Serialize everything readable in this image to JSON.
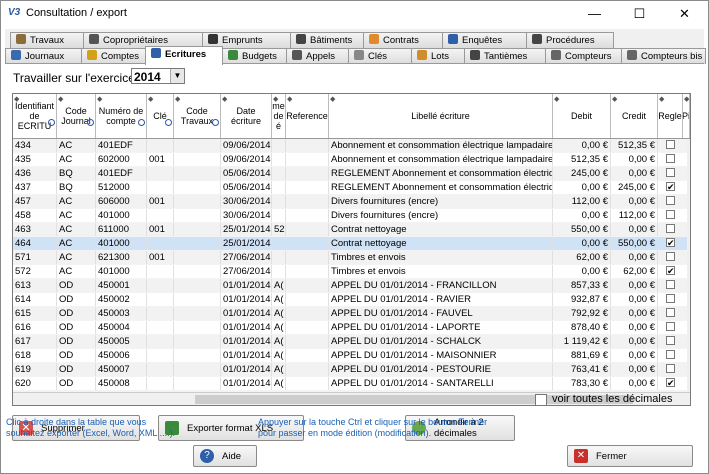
{
  "window": {
    "app_icon_text": "V3",
    "title": "Consultation / export",
    "minimize": "—",
    "maximize": "☐",
    "close": "✕"
  },
  "tabs_row1": [
    {
      "label": "Travaux",
      "icon": "wrench-icon",
      "color": "#8a6d3b"
    },
    {
      "label": "Copropriétaires",
      "icon": "people-icon",
      "color": "#555555"
    },
    {
      "label": "Emprunts",
      "icon": "card-icon",
      "color": "#333333"
    },
    {
      "label": "Bâtiments",
      "icon": "building-icon",
      "color": "#444444"
    },
    {
      "label": "Contrats",
      "icon": "handshake-icon",
      "color": "#e08a2c"
    },
    {
      "label": "Enquêtes",
      "icon": "question-icon",
      "color": "#2f5fa8"
    },
    {
      "label": "Procédures",
      "icon": "gavel-icon",
      "color": "#444444"
    }
  ],
  "tabs_row2": [
    {
      "label": "Journaux",
      "icon": "journal-icon",
      "color": "#3a6ab0"
    },
    {
      "label": "Comptes",
      "icon": "coins-icon",
      "color": "#d4a017"
    },
    {
      "label": "Ecritures",
      "icon": "ledger-icon",
      "color": "#2f5fa8",
      "active": true
    },
    {
      "label": "Budgets",
      "icon": "chart-icon",
      "color": "#3b8a3b"
    },
    {
      "label": "Appels",
      "icon": "bell-icon",
      "color": "#555555"
    },
    {
      "label": "Clés",
      "icon": "key-icon",
      "color": "#888888"
    },
    {
      "label": "Lots",
      "icon": "house-icon",
      "color": "#d08c2a"
    },
    {
      "label": "Tantièmes",
      "icon": "bars-icon",
      "color": "#444444"
    },
    {
      "label": "Compteurs",
      "icon": "meter-icon",
      "color": "#666666"
    },
    {
      "label": "Compteurs bis",
      "icon": "meter-icon",
      "color": "#666666"
    }
  ],
  "exercise": {
    "label": "Travailler sur l'exercice",
    "value": "2014",
    "arrow": "▼"
  },
  "columns": [
    "Identifiant de ECRITU",
    "Code Journal",
    "Numéro de compte",
    "Clé",
    "Code Travaux",
    "Date écriture",
    "me de é",
    "Reference",
    "Libellé écriture",
    "Debit",
    "Credit",
    "Regle",
    "Pi"
  ],
  "rows": [
    {
      "id": "434",
      "journal": "AC",
      "compte": "401EDF",
      "cle": "",
      "travaux": "",
      "date": "09/06/2014",
      "me": "",
      "ref": "",
      "libelle": "Abonnement et consommation électrique lampadaires",
      "debit": "0,00 €",
      "credit": "512,35 €",
      "regle": false
    },
    {
      "id": "435",
      "journal": "AC",
      "compte": "602000",
      "cle": "001",
      "travaux": "",
      "date": "09/06/2014",
      "me": "",
      "ref": "",
      "libelle": "Abonnement et consommation électrique lampadaires",
      "debit": "512,35 €",
      "credit": "0,00 €",
      "regle": false
    },
    {
      "id": "436",
      "journal": "BQ",
      "compte": "401EDF",
      "cle": "",
      "travaux": "",
      "date": "05/06/2014",
      "me": "",
      "ref": "",
      "libelle": "REGLEMENT Abonnement et consommation électrique lan",
      "debit": "245,00 €",
      "credit": "0,00 €",
      "regle": false
    },
    {
      "id": "437",
      "journal": "BQ",
      "compte": "512000",
      "cle": "",
      "travaux": "",
      "date": "05/06/2014",
      "me": "",
      "ref": "",
      "libelle": "REGLEMENT Abonnement et consommation électrique lan",
      "debit": "0,00 €",
      "credit": "245,00 €",
      "regle": true
    },
    {
      "id": "457",
      "journal": "AC",
      "compte": "606000",
      "cle": "001",
      "travaux": "",
      "date": "30/06/2014",
      "me": "",
      "ref": "",
      "libelle": "Divers fournitures (encre)",
      "debit": "112,00 €",
      "credit": "0,00 €",
      "regle": false
    },
    {
      "id": "458",
      "journal": "AC",
      "compte": "401000",
      "cle": "",
      "travaux": "",
      "date": "30/06/2014",
      "me": "",
      "ref": "",
      "libelle": "Divers fournitures (encre)",
      "debit": "0,00 €",
      "credit": "112,00 €",
      "regle": false
    },
    {
      "id": "463",
      "journal": "AC",
      "compte": "611000",
      "cle": "001",
      "travaux": "",
      "date": "25/01/2014",
      "me": "52",
      "ref": "",
      "libelle": "Contrat nettoyage",
      "debit": "550,00 €",
      "credit": "0,00 €",
      "regle": false
    },
    {
      "id": "464",
      "journal": "AC",
      "compte": "401000",
      "cle": "",
      "travaux": "",
      "date": "25/01/2014",
      "me": "",
      "ref": "",
      "libelle": "Contrat nettoyage",
      "debit": "0,00 €",
      "credit": "550,00 €",
      "regle": true,
      "selected": true
    },
    {
      "id": "571",
      "journal": "AC",
      "compte": "621300",
      "cle": "001",
      "travaux": "",
      "date": "27/06/2014",
      "me": "",
      "ref": "",
      "libelle": "Timbres et envois",
      "debit": "62,00 €",
      "credit": "0,00 €",
      "regle": false
    },
    {
      "id": "572",
      "journal": "AC",
      "compte": "401000",
      "cle": "",
      "travaux": "",
      "date": "27/06/2014",
      "me": "",
      "ref": "",
      "libelle": "Timbres et envois",
      "debit": "0,00 €",
      "credit": "62,00 €",
      "regle": true
    },
    {
      "id": "613",
      "journal": "OD",
      "compte": "450001",
      "cle": "",
      "travaux": "",
      "date": "01/01/2014",
      "me": "A(",
      "ref": "",
      "libelle": "APPEL DU 01/01/2014 - FRANCILLON",
      "debit": "857,33 €",
      "credit": "0,00 €",
      "regle": false
    },
    {
      "id": "614",
      "journal": "OD",
      "compte": "450002",
      "cle": "",
      "travaux": "",
      "date": "01/01/2014",
      "me": "A(",
      "ref": "",
      "libelle": "APPEL DU 01/01/2014 - RAVIER",
      "debit": "932,87 €",
      "credit": "0,00 €",
      "regle": false
    },
    {
      "id": "615",
      "journal": "OD",
      "compte": "450003",
      "cle": "",
      "travaux": "",
      "date": "01/01/2014",
      "me": "A(",
      "ref": "",
      "libelle": "APPEL DU 01/01/2014 - FAUVEL",
      "debit": "792,92 €",
      "credit": "0,00 €",
      "regle": false
    },
    {
      "id": "616",
      "journal": "OD",
      "compte": "450004",
      "cle": "",
      "travaux": "",
      "date": "01/01/2014",
      "me": "A(",
      "ref": "",
      "libelle": "APPEL DU 01/01/2014 - LAPORTE",
      "debit": "878,40 €",
      "credit": "0,00 €",
      "regle": false
    },
    {
      "id": "617",
      "journal": "OD",
      "compte": "450005",
      "cle": "",
      "travaux": "",
      "date": "01/01/2014",
      "me": "A(",
      "ref": "",
      "libelle": "APPEL DU 01/01/2014 - SCHALCK",
      "debit": "1 119,42 €",
      "credit": "0,00 €",
      "regle": false
    },
    {
      "id": "618",
      "journal": "OD",
      "compte": "450006",
      "cle": "",
      "travaux": "",
      "date": "01/01/2014",
      "me": "A(",
      "ref": "",
      "libelle": "APPEL DU 01/01/2014 - MAISONNIER",
      "debit": "881,69 €",
      "credit": "0,00 €",
      "regle": false
    },
    {
      "id": "619",
      "journal": "OD",
      "compte": "450007",
      "cle": "",
      "travaux": "",
      "date": "01/01/2014",
      "me": "A(",
      "ref": "",
      "libelle": "APPEL DU 01/01/2014 - PESTOURIE",
      "debit": "763,41 €",
      "credit": "0,00 €",
      "regle": false
    },
    {
      "id": "620",
      "journal": "OD",
      "compte": "450008",
      "cle": "",
      "travaux": "",
      "date": "01/01/2014",
      "me": "A(",
      "ref": "",
      "libelle": "APPEL DU 01/01/2014 - SANTARELLI",
      "debit": "783,30 €",
      "credit": "0,00 €",
      "regle": true
    }
  ],
  "buttons": {
    "delete": "Supprimer",
    "export": "Exporter format XLS",
    "round": "Arrondir à 2 décimales",
    "help": "Aide",
    "close": "Fermer"
  },
  "show_decimals": "voir toutes les décimales",
  "help_left": "Clic à droite dans la table que vous souhaitez exporter (Excel, Word, XML ....).",
  "help_right": "Appuyer sur la touche Ctrl et cliquer sur le bouton Fermer pour passer en mode édition (modification).",
  "colors": {
    "selected_row": "#cfe2f6",
    "help_text": "#1a5fb4",
    "alt_row": "#f2f2f2"
  }
}
